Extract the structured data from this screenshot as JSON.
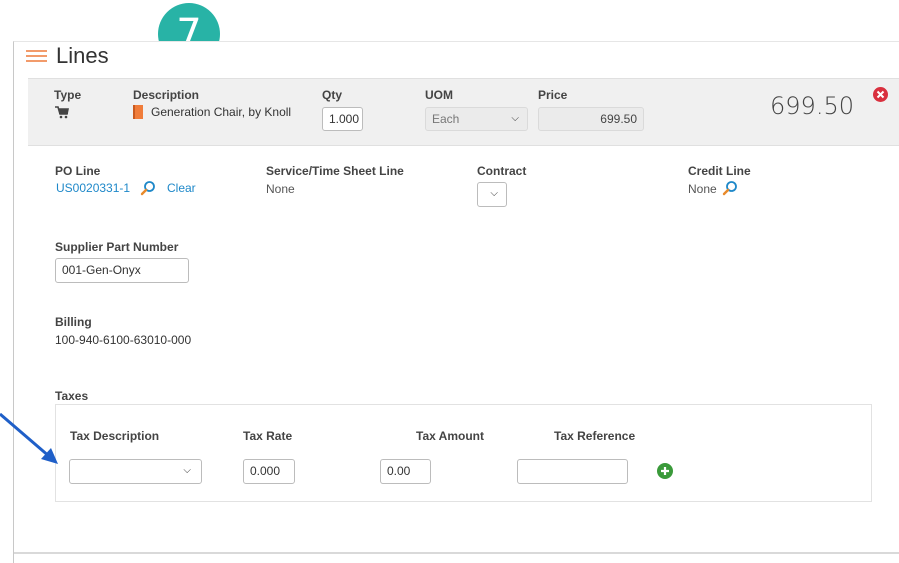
{
  "step_badge": "7",
  "section": {
    "title": "Lines"
  },
  "line_header": {
    "type_label": "Type",
    "description_label": "Description",
    "description_value": "Generation Chair, by Knoll",
    "qty_label": "Qty",
    "qty_value": "1.000",
    "uom_label": "UOM",
    "uom_value": "Each",
    "price_label": "Price",
    "price_value": "699.50",
    "total": "699.50"
  },
  "details": {
    "po_line_label": "PO Line",
    "po_line_value": "US0020331-1",
    "clear_label": "Clear",
    "service_label": "Service/Time Sheet Line",
    "service_value": "None",
    "contract_label": "Contract",
    "credit_label": "Credit Line",
    "credit_value": "None",
    "supplier_part_label": "Supplier Part Number",
    "supplier_part_value": "001-Gen-Onyx",
    "billing_label": "Billing",
    "billing_value": "100-940-6100-63010-000"
  },
  "taxes": {
    "title": "Taxes",
    "col_description": "Tax Description",
    "col_rate": "Tax Rate",
    "col_amount": "Tax Amount",
    "col_reference": "Tax Reference",
    "rate_value": "0.000",
    "amount_value": "0.00",
    "reference_value": ""
  },
  "colors": {
    "badge": "#28b3a6",
    "link": "#1e88c9",
    "remove": "#d9303e",
    "add": "#3a9a3a",
    "arrow": "#1f5fc8"
  }
}
